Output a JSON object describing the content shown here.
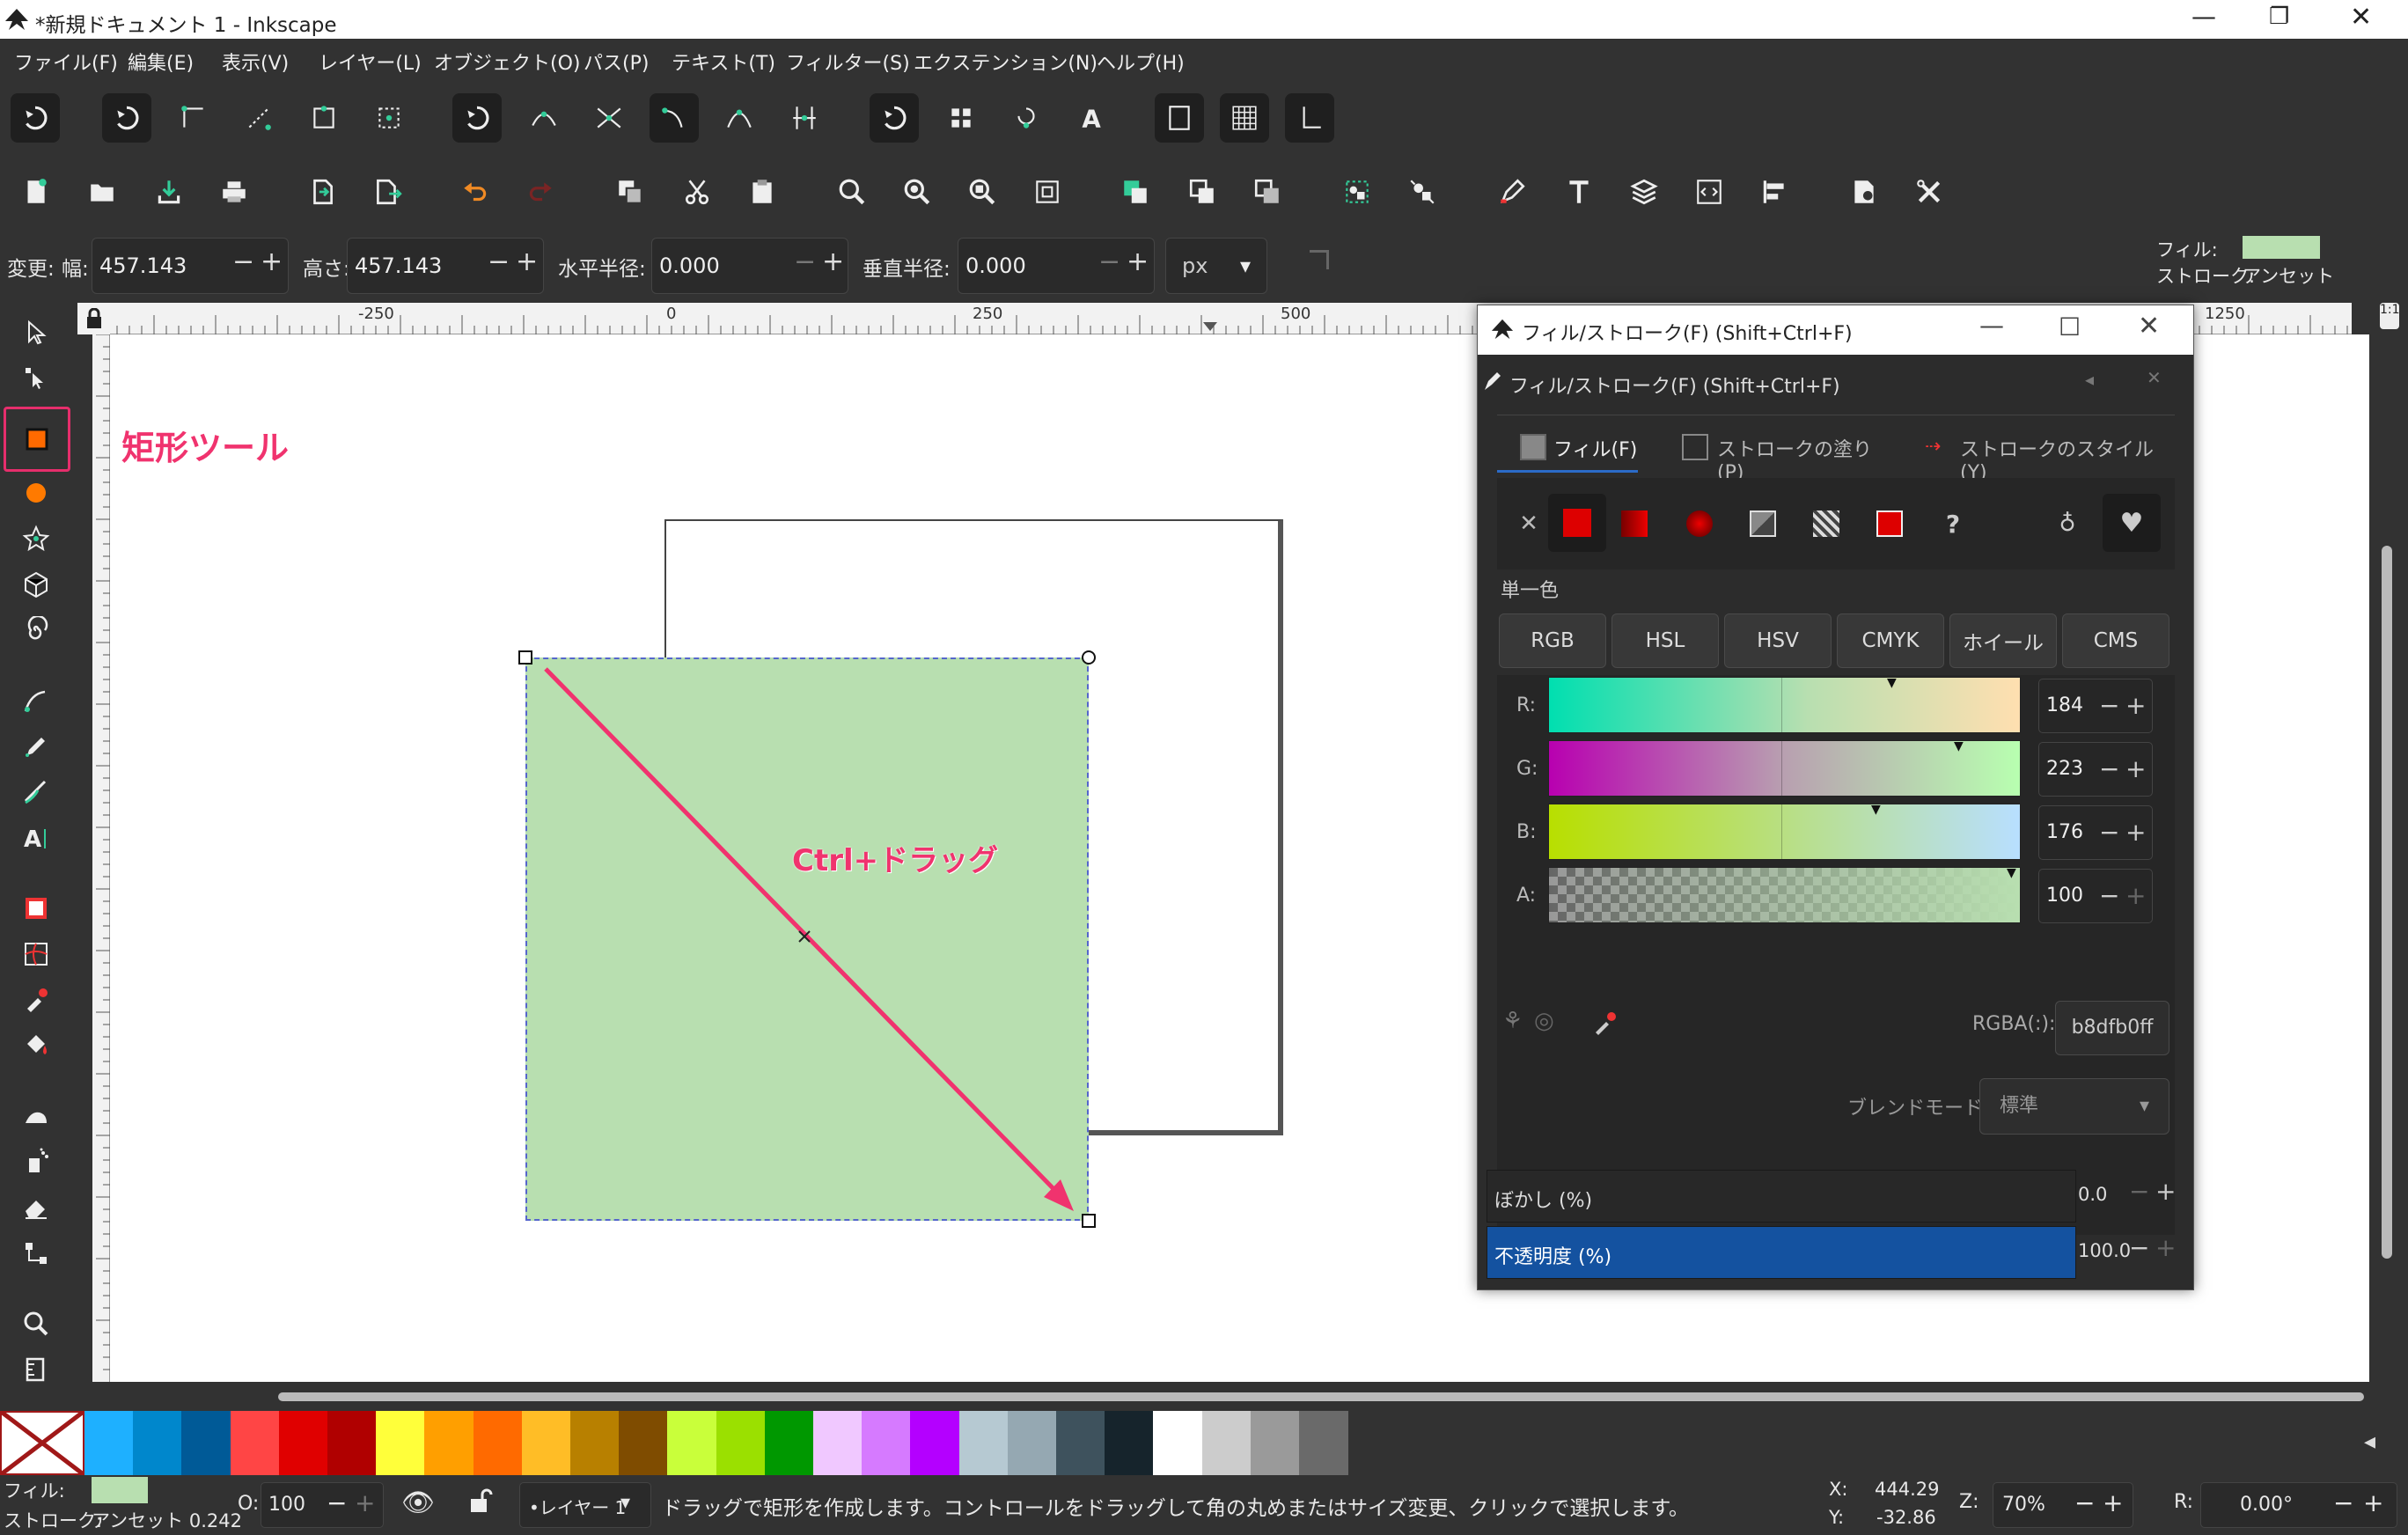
{
  "window": {
    "title": "*新規ドキュメント 1 - Inkscape"
  },
  "menu": [
    "ファイル(F)",
    "編集(E)",
    "表示(V)",
    "レイヤー(L)",
    "オブジェクト(O)",
    "パス(P)",
    "テキスト(T)",
    "フィルター(S)",
    "エクステンション(N)",
    "ヘルプ(H)"
  ],
  "toolctrl": {
    "change_label": "変更:",
    "width_label": "幅:",
    "width_value": "457.143",
    "height_label": "高さ:",
    "height_value": "457.143",
    "rx_label": "水平半径:",
    "rx_value": "0.000",
    "ry_label": "垂直半径:",
    "ry_value": "0.000",
    "unit": "px"
  },
  "style_indicator": {
    "fill_label": "フィル:",
    "stroke_label": "ストローク:",
    "stroke_value": "アンセット",
    "fill_color": "#b8dfb0"
  },
  "ruler": {
    "ticks": [
      "-250",
      "0",
      "250",
      "500",
      "1250"
    ]
  },
  "annotations": {
    "rect_tool": "矩形ツール",
    "drag": "Ctrl+ドラッグ"
  },
  "dialog": {
    "title": "フィル/ストローク(F) (Shift+Ctrl+F)",
    "subtitle": "フィル/ストローク(F) (Shift+Ctrl+F)",
    "tabs": [
      "フィル(F)",
      "ストロークの塗り(P)",
      "ストロークのスタイル(Y)"
    ],
    "flat_label": "単一色",
    "modes": [
      "RGB",
      "HSL",
      "HSV",
      "CMYK",
      "ホイール",
      "CMS"
    ],
    "channels": [
      {
        "label": "R:",
        "value": "184"
      },
      {
        "label": "G:",
        "value": "223"
      },
      {
        "label": "B:",
        "value": "176"
      },
      {
        "label": "A:",
        "value": "100"
      }
    ],
    "rgba_label": "RGBA(:):",
    "rgba_value": "b8dfb0ff",
    "blend_label": "ブレンドモード:",
    "blend_value": "標準",
    "blur_label": "ぼかし (%)",
    "blur_value": "0.0",
    "opacity_label": "不透明度 (%)",
    "opacity_value": "100.0"
  },
  "palette": [
    "#1eb0ff",
    "#0087cc",
    "#005a97",
    "#ff4545",
    "#e00000",
    "#b00000",
    "#ffff3a",
    "#ff9f00",
    "#ff6a00",
    "#ffbd26",
    "#b88000",
    "#7f4c00",
    "#c9ff3a",
    "#9be000",
    "#009800",
    "#f0c8ff",
    "#d67aff",
    "#b400ff",
    "#b6c9d2",
    "#95a8b2",
    "#3e525d",
    "#16242c",
    "#ffffff",
    "#cccccc",
    "#9a9a9a",
    "#6a6a6a"
  ],
  "status": {
    "fill_label": "フィル:",
    "stroke_label": "ストローク:",
    "stroke_value": "アンセット 0.242",
    "o_label": "O:",
    "o_value": "100",
    "layer": "•レイヤー 1",
    "message": "ドラッグで矩形を作成します。コントロールをドラッグして角の丸めまたはサイズ変更、クリックで選択します。",
    "x_label": "X:",
    "x_value": "444.29",
    "y_label": "Y:",
    "y_value": "-32.86",
    "z_label": "Z:",
    "zoom": "70%",
    "r_label": "R:",
    "rotation": "0.00°"
  }
}
